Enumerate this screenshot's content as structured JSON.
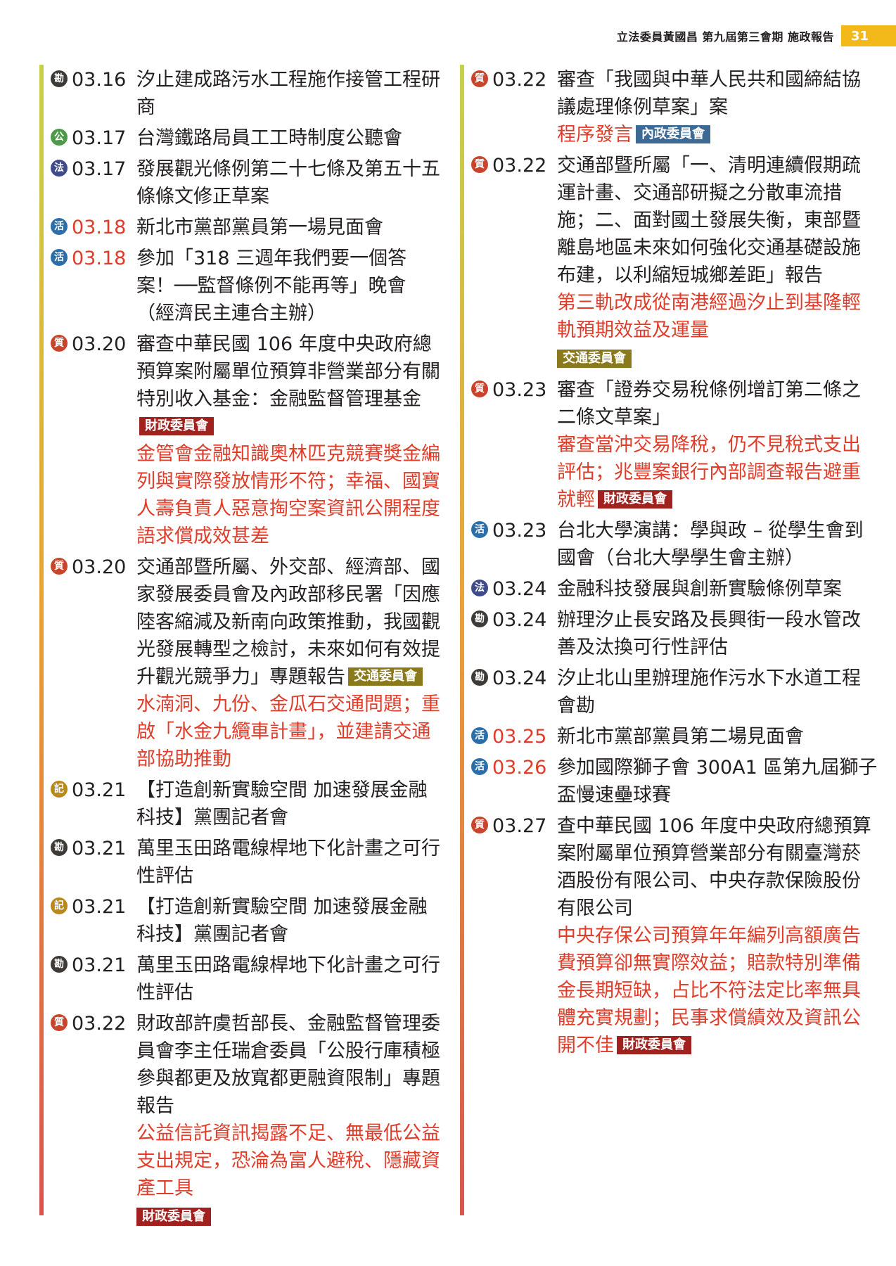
{
  "header": {
    "title": "立法委員黃國昌 第九屆第三會期 施政報告",
    "page": "31"
  },
  "left": [
    {
      "icon": "勘",
      "type": "inspect",
      "date": "03.16",
      "title": "汐止建成路污水工程施作接管工程研商"
    },
    {
      "icon": "公",
      "type": "public",
      "date": "03.17",
      "title": "台灣鐵路局員工工時制度公聽會"
    },
    {
      "icon": "法",
      "type": "law",
      "date": "03.17",
      "title": "發展觀光條例第二十七條及第五十五條條文修正草案"
    },
    {
      "icon": "活",
      "type": "activity",
      "date": "03.18",
      "date_red": true,
      "title": "新北市黨部黨員第一場見面會"
    },
    {
      "icon": "活",
      "type": "activity",
      "date": "03.18",
      "date_red": true,
      "title": "參加「318 三週年我們要一個答案！──監督條例不能再等」晚會（經濟民主連合主辦）"
    },
    {
      "icon": "質",
      "type": "question",
      "date": "03.20",
      "title": "審查中華民國 106 年度中央政府總預算案附屬單位預算非營業部分有關特別收入基金：金融監督管理基金",
      "tag": "財政委員會",
      "tag_type": "finance",
      "note": "金管會金融知識奧林匹克競賽獎金編列與實際發放情形不符；幸福、國寶人壽負責人惡意掏空案資訊公開程度語求償成效甚差"
    },
    {
      "icon": "質",
      "type": "question",
      "date": "03.20",
      "title": "交通部暨所屬、外交部、經濟部、國家發展委員會及內政部移民署「因應陸客縮減及新南向政策推動，我國觀光發展轉型之檢討，未來如何有效提升觀光競爭力」專題報告",
      "tag": "交通委員會",
      "tag_type": "transport",
      "note": "水湳洞、九份、金瓜石交通問題；重啟「水金九纜車計畫」，並建請交通部協助推動"
    },
    {
      "icon": "記",
      "type": "press",
      "date": "03.21",
      "title": "【打造創新實驗空間 加速發展金融科技】黨團記者會"
    },
    {
      "icon": "勘",
      "type": "inspect",
      "date": "03.21",
      "title": "萬里玉田路電線桿地下化計畫之可行性評估"
    },
    {
      "icon": "記",
      "type": "press",
      "date": "03.21",
      "title": "【打造創新實驗空間 加速發展金融科技】黨團記者會"
    },
    {
      "icon": "勘",
      "type": "inspect",
      "date": "03.21",
      "title": "萬里玉田路電線桿地下化計畫之可行性評估"
    },
    {
      "icon": "質",
      "type": "question",
      "date": "03.22",
      "title": "財政部許虞哲部長、金融監督管理委員會李主任瑞倉委員「公股行庫積極參與都更及放寬都更融資限制」專題報告",
      "note": "公益信託資訊揭露不足、無最低公益支出規定，恐淪為富人避稅、隱藏資產工具",
      "tag": "財政委員會",
      "tag_type": "finance",
      "tag_own_line": true
    }
  ],
  "right": [
    {
      "icon": "質",
      "type": "question",
      "date": "03.22",
      "title": "審查「我國與中華人民共和國締結協議處理條例草案」案",
      "note": "程序發言",
      "tag": "內政委員會",
      "tag_type": "interior",
      "tag_after_note": true
    },
    {
      "icon": "質",
      "type": "question",
      "date": "03.22",
      "title": "交通部暨所屬「一、清明連續假期疏運計畫、交通部研擬之分散車流措施；二、面對國土發展失衡，東部暨離島地區未來如何強化交通基礎設施布建，以利縮短城鄉差距」報告",
      "note": "第三軌改成從南港經過汐止到基隆輕軌預期效益及運量",
      "tag": "交通委員會",
      "tag_type": "transport",
      "tag_own_line": true
    },
    {
      "icon": "質",
      "type": "question",
      "date": "03.23",
      "title": "審查「證券交易稅條例增訂第二條之二條文草案」",
      "note": "審查當沖交易降稅，仍不見稅式支出評估；兆豐案銀行內部調查報告避重就輕",
      "tag": "財政委員會",
      "tag_type": "finance",
      "tag_after_note": true
    },
    {
      "icon": "活",
      "type": "activity",
      "date": "03.23",
      "title": "台北大學演講：學與政 – 從學生會到國會（台北大學學生會主辦）"
    },
    {
      "icon": "法",
      "type": "law",
      "date": "03.24",
      "title": "金融科技發展與創新實驗條例草案"
    },
    {
      "icon": "勘",
      "type": "inspect",
      "date": "03.24",
      "title": "辦理汐止長安路及長興街一段水管改善及汰換可行性評估"
    },
    {
      "icon": "勘",
      "type": "inspect",
      "date": "03.24",
      "title": "汐止北山里辦理施作污水下水道工程會勘"
    },
    {
      "icon": "活",
      "type": "activity",
      "date": "03.25",
      "date_red": true,
      "title": "新北市黨部黨員第二場見面會"
    },
    {
      "icon": "活",
      "type": "activity",
      "date": "03.26",
      "date_red": true,
      "title": "參加國際獅子會 300A1 區第九屆獅子盃慢速壘球賽"
    },
    {
      "icon": "質",
      "type": "question",
      "date": "03.27",
      "title": "查中華民國 106 年度中央政府總預算案附屬單位預算營業部分有關臺灣菸酒股份有限公司、中央存款保險股份有限公司",
      "note": "中央存保公司預算年年編列高額廣告費預算卻無實際效益；賠款特別準備金長期短缺，占比不符法定比率無具體充實規劃；民事求償績效及資訊公開不佳",
      "tag": "財政委員會",
      "tag_type": "finance",
      "tag_after_note": true
    }
  ]
}
